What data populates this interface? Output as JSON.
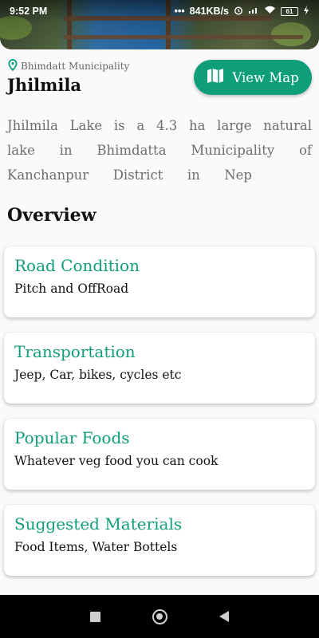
{
  "status_bar": {
    "time": "9:52 PM",
    "network_speed": "841KB/s",
    "battery": "61",
    "icons": [
      "dots-icon",
      "alarm-icon",
      "signal-icon",
      "wifi-icon",
      "battery-icon",
      "charging-icon"
    ]
  },
  "place": {
    "location": "Bhimdatt Municipality",
    "name": "Jhilmila",
    "view_map_label": "View Map",
    "description_lines": [
      "Jhilmila Lake is a 4.3 ha large natural",
      "lake in Bhimdatta Municipality of",
      "Kanchanpur District in Nep"
    ]
  },
  "overview": {
    "title": "Overview",
    "cards": [
      {
        "heading": "Road Condition",
        "body": "Pitch and OffRoad"
      },
      {
        "heading": "Transportation",
        "body": "Jeep, Car, bikes, cycles etc"
      },
      {
        "heading": "Popular Foods",
        "body": "Whatever veg food you can cook"
      },
      {
        "heading": "Suggested Materials",
        "body": "Food Items, Water Bottels"
      }
    ]
  },
  "colors": {
    "accent": "#0f9e7a",
    "background": "#fafafa",
    "text": "#111111",
    "muted": "#6d6d6d"
  }
}
